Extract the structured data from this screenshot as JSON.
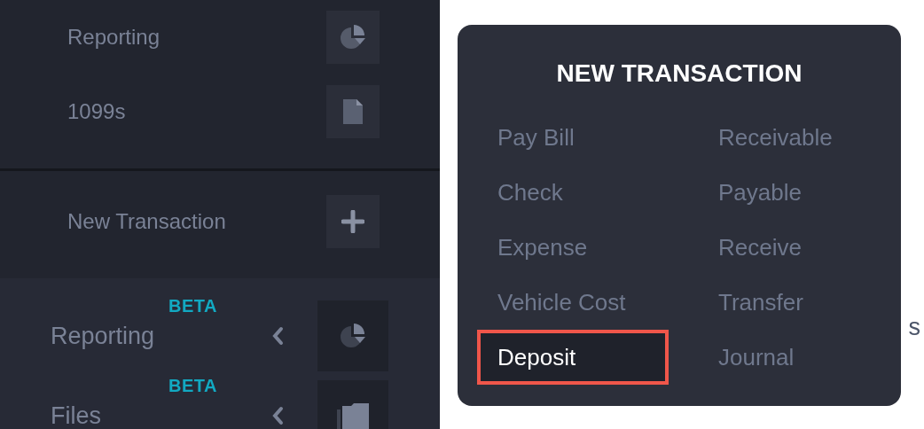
{
  "sidebar": {
    "top_items": [
      {
        "label": "Reporting",
        "kind": "pie"
      },
      {
        "label": "1099s",
        "kind": "document"
      }
    ],
    "action": {
      "label": "New Transaction",
      "kind": "plus"
    },
    "nav_items": [
      {
        "label": "Reporting",
        "badge": "BETA",
        "kind": "pie"
      },
      {
        "label": "Files",
        "badge": "BETA",
        "kind": "folder"
      }
    ]
  },
  "background_fragment": "s",
  "popup": {
    "title": "NEW TRANSACTION",
    "items": [
      {
        "label": "Pay Bill",
        "selected": false
      },
      {
        "label": "Check",
        "selected": false
      },
      {
        "label": "Expense",
        "selected": false
      },
      {
        "label": "Vehicle Cost",
        "selected": false
      },
      {
        "label": "Deposit",
        "selected": true
      },
      {
        "label": "Receivable",
        "selected": false
      },
      {
        "label": "Payable",
        "selected": false
      },
      {
        "label": "Receive",
        "selected": false
      },
      {
        "label": "Transfer",
        "selected": false
      },
      {
        "label": "Journal",
        "selected": false
      }
    ]
  }
}
